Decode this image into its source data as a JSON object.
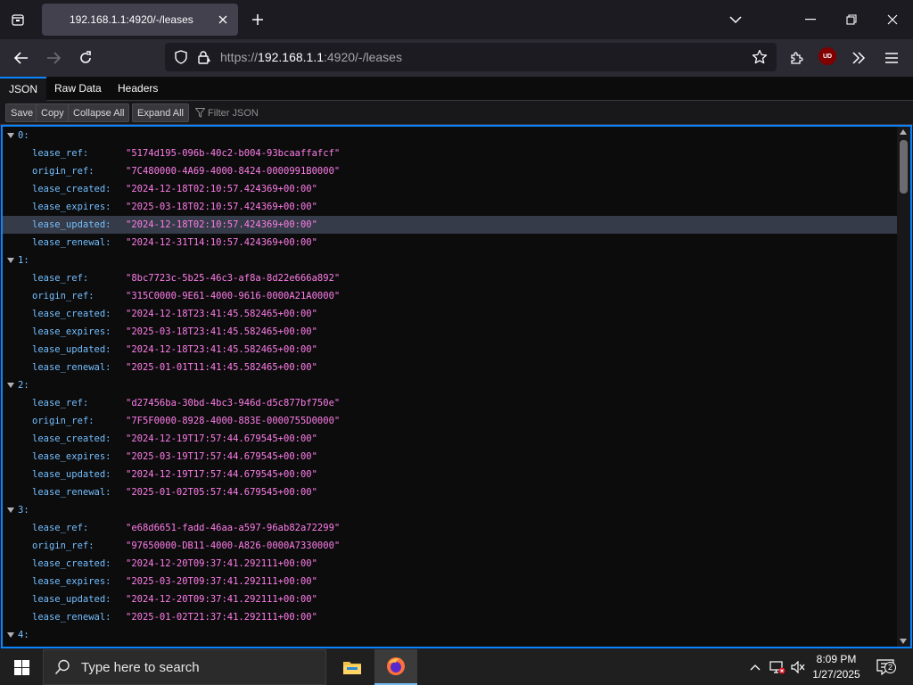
{
  "browser": {
    "tab": {
      "title": "192.168.1.1:4920/-/leases"
    },
    "url": {
      "scheme": "https://",
      "host": "192.168.1.1",
      "rest": ":4920/-/leases"
    },
    "extension_badge": "UD"
  },
  "viewer": {
    "tabs": [
      {
        "label": "JSON",
        "active": true
      },
      {
        "label": "Raw Data",
        "active": false
      },
      {
        "label": "Headers",
        "active": false
      }
    ],
    "toolbar": {
      "save_label": "Save",
      "copy_label": "Copy",
      "collapse_label": "Collapse All",
      "expand_label": "Expand All",
      "filter_placeholder": "Filter JSON"
    }
  },
  "json": {
    "entries": [
      {
        "index": "0:",
        "fields": [
          {
            "key": "lease_ref:",
            "value": "\"5174d195-096b-40c2-b004-93bcaaffafcf\""
          },
          {
            "key": "origin_ref:",
            "value": "\"7C480000-4A69-4000-8424-0000991B0000\""
          },
          {
            "key": "lease_created:",
            "value": "\"2024-12-18T02:10:57.424369+00:00\""
          },
          {
            "key": "lease_expires:",
            "value": "\"2025-03-18T02:10:57.424369+00:00\""
          },
          {
            "key": "lease_updated:",
            "value": "\"2024-12-18T02:10:57.424369+00:00\""
          },
          {
            "key": "lease_renewal:",
            "value": "\"2024-12-31T14:10:57.424369+00:00\""
          }
        ]
      },
      {
        "index": "1:",
        "fields": [
          {
            "key": "lease_ref:",
            "value": "\"8bc7723c-5b25-46c3-af8a-8d22e666a892\""
          },
          {
            "key": "origin_ref:",
            "value": "\"315C0000-9E61-4000-9616-0000A21A0000\""
          },
          {
            "key": "lease_created:",
            "value": "\"2024-12-18T23:41:45.582465+00:00\""
          },
          {
            "key": "lease_expires:",
            "value": "\"2025-03-18T23:41:45.582465+00:00\""
          },
          {
            "key": "lease_updated:",
            "value": "\"2024-12-18T23:41:45.582465+00:00\""
          },
          {
            "key": "lease_renewal:",
            "value": "\"2025-01-01T11:41:45.582465+00:00\""
          }
        ]
      },
      {
        "index": "2:",
        "fields": [
          {
            "key": "lease_ref:",
            "value": "\"d27456ba-30bd-4bc3-946d-d5c877bf750e\""
          },
          {
            "key": "origin_ref:",
            "value": "\"7F5F0000-8928-4000-883E-0000755D0000\""
          },
          {
            "key": "lease_created:",
            "value": "\"2024-12-19T17:57:44.679545+00:00\""
          },
          {
            "key": "lease_expires:",
            "value": "\"2025-03-19T17:57:44.679545+00:00\""
          },
          {
            "key": "lease_updated:",
            "value": "\"2024-12-19T17:57:44.679545+00:00\""
          },
          {
            "key": "lease_renewal:",
            "value": "\"2025-01-02T05:57:44.679545+00:00\""
          }
        ]
      },
      {
        "index": "3:",
        "fields": [
          {
            "key": "lease_ref:",
            "value": "\"e68d6651-fadd-46aa-a597-96ab82a72299\""
          },
          {
            "key": "origin_ref:",
            "value": "\"97650000-DB11-4000-A826-0000A7330000\""
          },
          {
            "key": "lease_created:",
            "value": "\"2024-12-20T09:37:41.292111+00:00\""
          },
          {
            "key": "lease_expires:",
            "value": "\"2025-03-20T09:37:41.292111+00:00\""
          },
          {
            "key": "lease_updated:",
            "value": "\"2024-12-20T09:37:41.292111+00:00\""
          },
          {
            "key": "lease_renewal:",
            "value": "\"2025-01-02T21:37:41.292111+00:00\""
          }
        ]
      },
      {
        "index": "4:",
        "fields": []
      }
    ],
    "highlighted": {
      "entry": 0,
      "field": 4
    }
  },
  "taskbar": {
    "search_placeholder": "Type here to search",
    "time": "8:09 PM",
    "date": "1/27/2025",
    "notification_count": "2"
  },
  "colors": {
    "accent": "#0a84ff",
    "json_key": "#75bfff",
    "json_string": "#ff7de9",
    "row_highlight": "#353b48"
  }
}
